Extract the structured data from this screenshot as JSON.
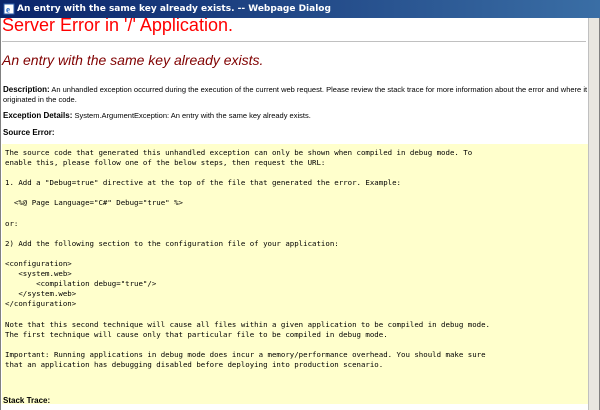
{
  "window": {
    "title": "An entry with the same key already exists. -- Webpage Dialog"
  },
  "page": {
    "heading": "Server Error in '/' Application.",
    "subheading": "An entry with the same key already exists.",
    "description_label": "Description:",
    "description_text": "An unhandled exception occurred during the execution of the current web request. Please review the stack trace for more information about the error and where it",
    "description_text_2": "originated in the code.",
    "exception_label": "Exception Details:",
    "exception_text": "System.ArgumentException: An entry with the same key already exists.",
    "source_error_label": "Source Error:",
    "source_error_lines": [
      "The source code that generated this unhandled exception can only be shown when compiled in debug mode. To",
      "enable this, please follow one of the below steps, then request the URL:",
      "",
      "1. Add a \"Debug=true\" directive at the top of the file that generated the error. Example:",
      "",
      "  <%@ Page Language=\"C#\" Debug=\"true\" %>",
      "",
      "or:",
      "",
      "2) Add the following section to the configuration file of your application:",
      "",
      "<configuration>",
      "   <system.web>",
      "       <compilation debug=\"true\"/>",
      "   </system.web>",
      "</configuration>",
      "",
      "Note that this second technique will cause all files within a given application to be compiled in debug mode.",
      "The first technique will cause only that particular file to be compiled in debug mode.",
      "",
      "Important: Running applications in debug mode does incur a memory/performance overhead. You should make sure",
      "that an application has debugging disabled before deploying into production scenario."
    ],
    "stack_trace_label": "Stack Trace:"
  }
}
